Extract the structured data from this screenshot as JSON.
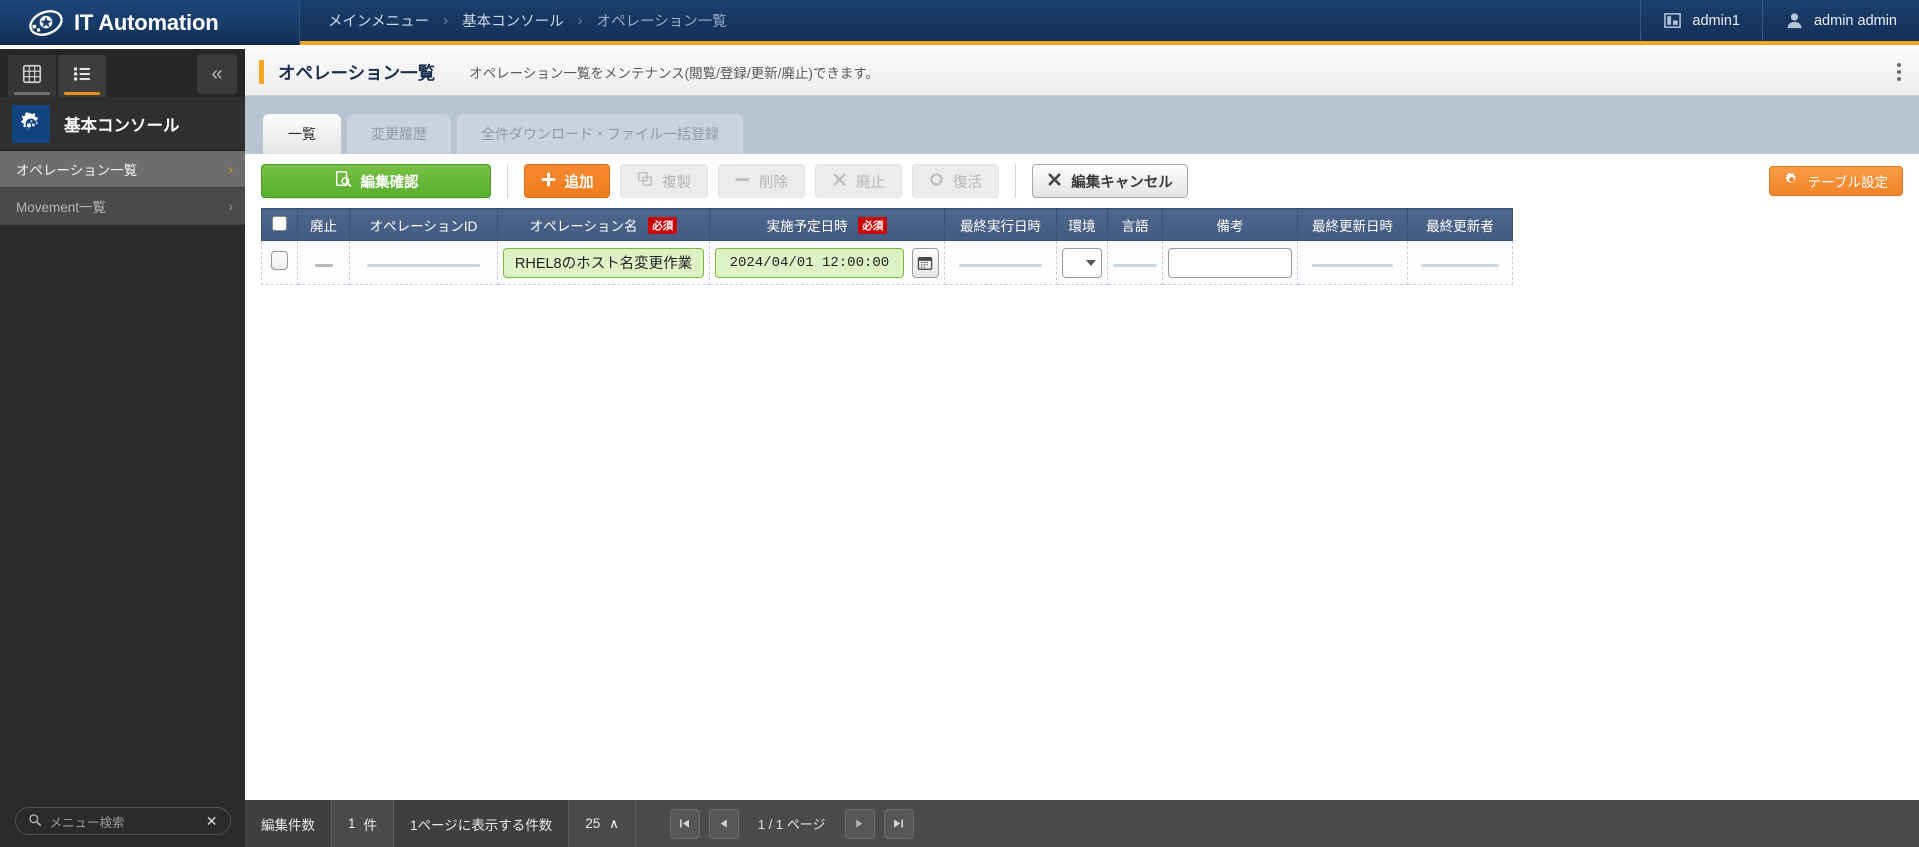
{
  "topbar": {
    "brand": "IT Automation",
    "brand_logo_icon": "swirl-logo-icon",
    "breadcrumb": [
      "メインメニュー",
      "基本コンソール",
      "オペレーション一覧"
    ],
    "breadcrumb_separator": "›",
    "workspace": {
      "label": "admin1",
      "icon": "workspace-icon"
    },
    "user": {
      "label": "admin admin",
      "icon": "user-avatar-icon"
    }
  },
  "sidebar": {
    "tabs": [
      {
        "name": "grid-view",
        "icon": "grid-icon",
        "active": false
      },
      {
        "name": "list-view",
        "icon": "list-icon",
        "active": true
      }
    ],
    "collapse_icon": "chevron-double-left-icon",
    "header": {
      "label": "基本コンソール",
      "icon": "gear-console-icon"
    },
    "items": [
      {
        "label": "オペレーション一覧",
        "selected": true,
        "chevron": "›"
      },
      {
        "label": "Movement一覧",
        "selected": false,
        "chevron": "›"
      }
    ],
    "search": {
      "placeholder": "メニュー検索",
      "value": "",
      "icon": "search-icon",
      "clear_icon": "close-icon"
    }
  },
  "page": {
    "title": "オペレーション一覧",
    "description": "オペレーション一覧をメンテナンス(閲覧/登録/更新/廃止)できます。",
    "menu_icon": "kebab-menu-icon"
  },
  "tabs": [
    {
      "label": "一覧",
      "active": true
    },
    {
      "label": "変更履歴",
      "active": false
    },
    {
      "label": "全件ダウンロード・ファイル一括登録",
      "active": false
    }
  ],
  "toolbar": {
    "confirm_edit": {
      "label": "編集確認",
      "icon": "document-search-icon",
      "disabled": false
    },
    "add": {
      "label": "追加",
      "icon": "plus-icon",
      "disabled": false
    },
    "duplicate": {
      "label": "複製",
      "icon": "copy-icon",
      "disabled": true
    },
    "delete": {
      "label": "削除",
      "icon": "minus-icon",
      "disabled": true
    },
    "discard": {
      "label": "廃止",
      "icon": "x-icon",
      "disabled": true
    },
    "restore": {
      "label": "復活",
      "icon": "circle-icon",
      "disabled": true
    },
    "cancel_edit": {
      "label": "編集キャンセル",
      "icon": "x-icon",
      "disabled": false
    },
    "table_settings": {
      "label": "テーブル設定",
      "icon": "gear-icon",
      "disabled": false
    }
  },
  "table": {
    "columns": [
      {
        "label": "",
        "name": "select-all",
        "required": false
      },
      {
        "label": "廃止",
        "name": "discard",
        "required": false
      },
      {
        "label": "オペレーションID",
        "name": "operation-id",
        "required": false
      },
      {
        "label": "オペレーション名",
        "name": "operation-name",
        "required": true
      },
      {
        "label": "実施予定日時",
        "name": "scheduled-datetime",
        "required": true
      },
      {
        "label": "最終実行日時",
        "name": "last-exec-datetime",
        "required": false
      },
      {
        "label": "環境",
        "name": "environment",
        "required": false
      },
      {
        "label": "言語",
        "name": "language",
        "required": false
      },
      {
        "label": "備考",
        "name": "remarks",
        "required": false
      },
      {
        "label": "最終更新日時",
        "name": "last-update-datetime",
        "required": false
      },
      {
        "label": "最終更新者",
        "name": "last-updater",
        "required": false
      }
    ],
    "required_badge": "必須",
    "rows": [
      {
        "selected": false,
        "discard": "—",
        "operation_id": "",
        "operation_name": "RHEL8のホスト名変更作業",
        "scheduled_datetime": "2024/04/01 12:00:00",
        "calendar_icon": "calendar-icon",
        "last_exec_datetime": "",
        "environment": "",
        "language": "—",
        "remarks": "",
        "last_update_datetime": "",
        "last_updater": ""
      }
    ]
  },
  "footer": {
    "edit_count_label": "編集件数",
    "edit_count_value": "1",
    "edit_count_unit": "件",
    "per_page_label": "1ページに表示する件数",
    "per_page_value": "25",
    "per_page_caret": "∧",
    "first_icon": "first-page-icon",
    "prev_icon": "prev-page-icon",
    "next_icon": "next-page-icon",
    "last_icon": "last-page-icon",
    "page_current": "1",
    "page_sep": "/",
    "page_total": "1",
    "page_unit": "ページ"
  },
  "colors": {
    "brand_navy": "#12305a",
    "accent_orange": "#f5a623",
    "green": "#5bb030",
    "header_blue": "#49608a",
    "required_red": "#cc0000"
  }
}
